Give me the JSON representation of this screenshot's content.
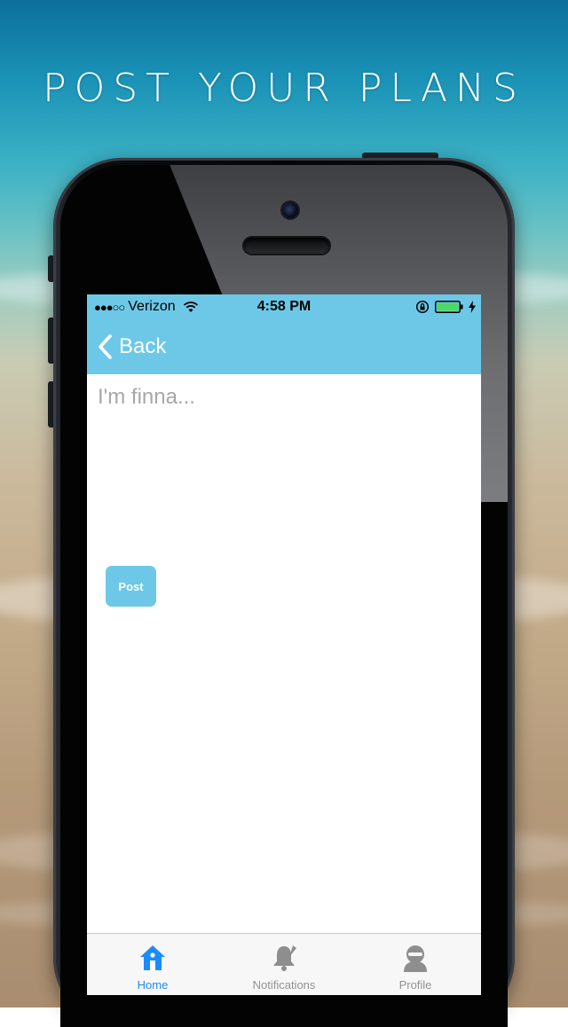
{
  "headline": "POST YOUR PLANS",
  "status_bar": {
    "signal": "●●●○○",
    "carrier": "Verizon",
    "time": "4:58 PM"
  },
  "nav": {
    "back_label": "Back",
    "back_icon": "chevron-left-icon"
  },
  "composer": {
    "placeholder": "I'm finna...",
    "value": ""
  },
  "post_button": {
    "label": "Post"
  },
  "tabs": [
    {
      "label": "Home",
      "icon": "home-icon",
      "active": true
    },
    {
      "label": "Notifications",
      "icon": "bell-icon",
      "active": false
    },
    {
      "label": "Profile",
      "icon": "profile-icon",
      "active": false
    }
  ],
  "colors": {
    "accent": "#6dc8e8",
    "tab_active": "#1a8cff",
    "tab_inactive": "#929292",
    "placeholder": "#a7a7a7"
  }
}
